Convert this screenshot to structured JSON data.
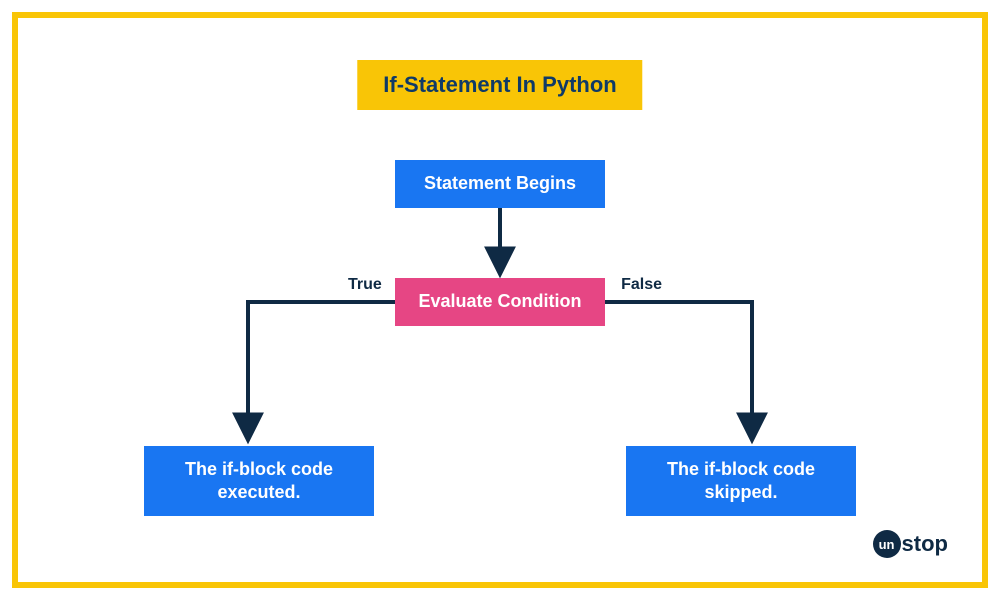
{
  "title": "If-Statement In Python",
  "nodes": {
    "begin": "Statement Begins",
    "condition": "Evaluate Condition",
    "exec": "The if-block code executed.",
    "skip": "The if-block code skipped."
  },
  "labels": {
    "true": "True",
    "false": "False"
  },
  "logo": {
    "circle": "un",
    "rest": "stop"
  },
  "colors": {
    "border": "#f9c506",
    "title_bg": "#f9c506",
    "title_fg": "#0f3a67",
    "blue": "#1976f2",
    "pink": "#e64684",
    "arrow": "#0f2a44"
  }
}
